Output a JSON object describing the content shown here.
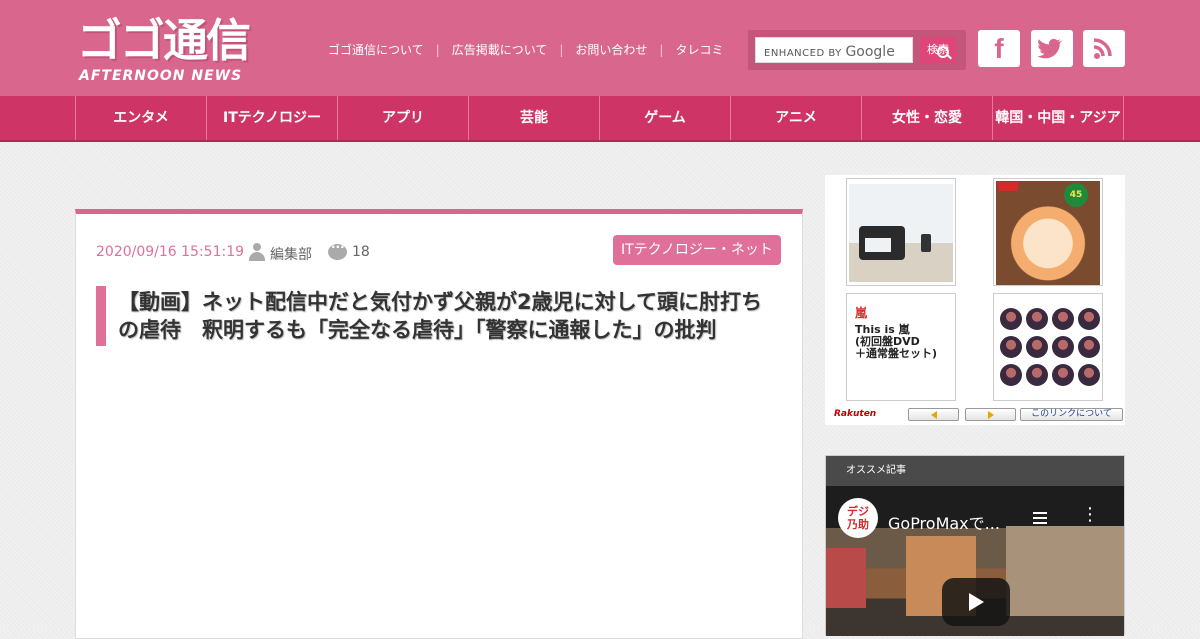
{
  "site": {
    "logo_main": "ゴゴ通信",
    "logo_sub": "AFTERNOON NEWS"
  },
  "header_links": [
    "ゴゴ通信について",
    "広告掲載について",
    "お問い合わせ",
    "タレコミ"
  ],
  "search": {
    "enhanced_by": "ENHANCED BY",
    "google": "Google",
    "button_label": "検索"
  },
  "social": {
    "facebook_icon": "facebook-icon",
    "twitter_icon": "twitter-icon",
    "rss_icon": "rss-icon"
  },
  "nav": [
    "エンタメ",
    "ITテクノロジー",
    "アプリ",
    "芸能",
    "ゲーム",
    "アニメ",
    "女性・恋愛",
    "韓国・中国・アジア"
  ],
  "article": {
    "date": "2020/09/16 15:51:19",
    "author": "編集部",
    "comment_count": "18",
    "category": "ITテクノロジー・ネット",
    "title": "【動画】ネット配信中だと気付かず父親が2歳児に対して頭に肘打ちの虐待　釈明するも「完全なる虐待」「警察に通報した」の批判"
  },
  "ad": {
    "arashi_name": "嵐",
    "arashi_text": "This is 嵐\n(初回盤DVD\n＋通常盤セット)",
    "logo": "Rakuten",
    "about_link": "このリンクについて",
    "sushi_badge": "45"
  },
  "recommended": {
    "header": "オススメ記事",
    "channel": "デジ\n乃助",
    "video_title": "GoProMaxで..."
  },
  "colors": {
    "header_pink": "#d9678d",
    "nav_pink": "#cf3467",
    "accent": "#e0709a"
  }
}
